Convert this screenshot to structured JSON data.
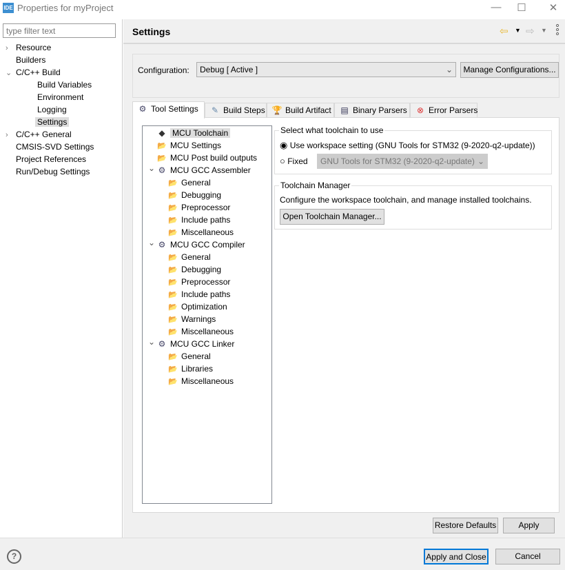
{
  "window": {
    "title": "Properties for myProject",
    "logo": "IDE",
    "minimize": "—",
    "maximize": "☐",
    "close": "✕"
  },
  "filter": {
    "placeholder": "type filter text"
  },
  "nav": [
    {
      "label": "Resource",
      "level": 0,
      "chev": "›"
    },
    {
      "label": "Builders",
      "level": 0,
      "chev": ""
    },
    {
      "label": "C/C++ Build",
      "level": 0,
      "chev": "⌄"
    },
    {
      "label": "Build Variables",
      "level": 1,
      "chev": ""
    },
    {
      "label": "Environment",
      "level": 1,
      "chev": ""
    },
    {
      "label": "Logging",
      "level": 1,
      "chev": ""
    },
    {
      "label": "Settings",
      "level": 1,
      "chev": "",
      "selected": true
    },
    {
      "label": "C/C++ General",
      "level": 0,
      "chev": "›"
    },
    {
      "label": "CMSIS-SVD Settings",
      "level": 0,
      "chev": ""
    },
    {
      "label": "Project References",
      "level": 0,
      "chev": ""
    },
    {
      "label": "Run/Debug Settings",
      "level": 0,
      "chev": ""
    }
  ],
  "header": {
    "title": "Settings"
  },
  "config": {
    "label": "Configuration:",
    "value": "Debug  [ Active ]",
    "manage": "Manage Configurations..."
  },
  "tabs": [
    "Tool Settings",
    "Build Steps",
    "Build Artifact",
    "Binary Parsers",
    "Error Parsers"
  ],
  "tree": [
    {
      "label": "MCU Toolchain",
      "level": 0,
      "icon": "chip",
      "selected": true
    },
    {
      "label": "MCU Settings",
      "level": 0,
      "icon": "folder"
    },
    {
      "label": "MCU Post build outputs",
      "level": 0,
      "icon": "folder"
    },
    {
      "label": "MCU GCC Assembler",
      "level": 0,
      "icon": "gear",
      "expanded": true
    },
    {
      "label": "General",
      "level": 1,
      "icon": "folder"
    },
    {
      "label": "Debugging",
      "level": 1,
      "icon": "folder"
    },
    {
      "label": "Preprocessor",
      "level": 1,
      "icon": "folder"
    },
    {
      "label": "Include paths",
      "level": 1,
      "icon": "folder"
    },
    {
      "label": "Miscellaneous",
      "level": 1,
      "icon": "folder"
    },
    {
      "label": "MCU GCC Compiler",
      "level": 0,
      "icon": "gear",
      "expanded": true
    },
    {
      "label": "General",
      "level": 1,
      "icon": "folder"
    },
    {
      "label": "Debugging",
      "level": 1,
      "icon": "folder"
    },
    {
      "label": "Preprocessor",
      "level": 1,
      "icon": "folder"
    },
    {
      "label": "Include paths",
      "level": 1,
      "icon": "folder"
    },
    {
      "label": "Optimization",
      "level": 1,
      "icon": "folder"
    },
    {
      "label": "Warnings",
      "level": 1,
      "icon": "folder"
    },
    {
      "label": "Miscellaneous",
      "level": 1,
      "icon": "folder"
    },
    {
      "label": "MCU GCC Linker",
      "level": 0,
      "icon": "gear",
      "expanded": true
    },
    {
      "label": "General",
      "level": 1,
      "icon": "folder"
    },
    {
      "label": "Libraries",
      "level": 1,
      "icon": "folder"
    },
    {
      "label": "Miscellaneous",
      "level": 1,
      "icon": "folder"
    }
  ],
  "toolchain": {
    "group": "Select what toolchain to use",
    "workspace": "Use workspace setting (GNU Tools for STM32 (9-2020-q2-update))",
    "fixed": "Fixed",
    "fixed_value": "GNU Tools for STM32 (9-2020-q2-update)"
  },
  "manager": {
    "group": "Toolchain Manager",
    "desc": "Configure the workspace toolchain, and manage installed toolchains.",
    "button": "Open Toolchain Manager..."
  },
  "buttons": {
    "restore": "Restore Defaults",
    "apply": "Apply",
    "apply_close": "Apply and Close",
    "cancel": "Cancel",
    "help": "?"
  }
}
